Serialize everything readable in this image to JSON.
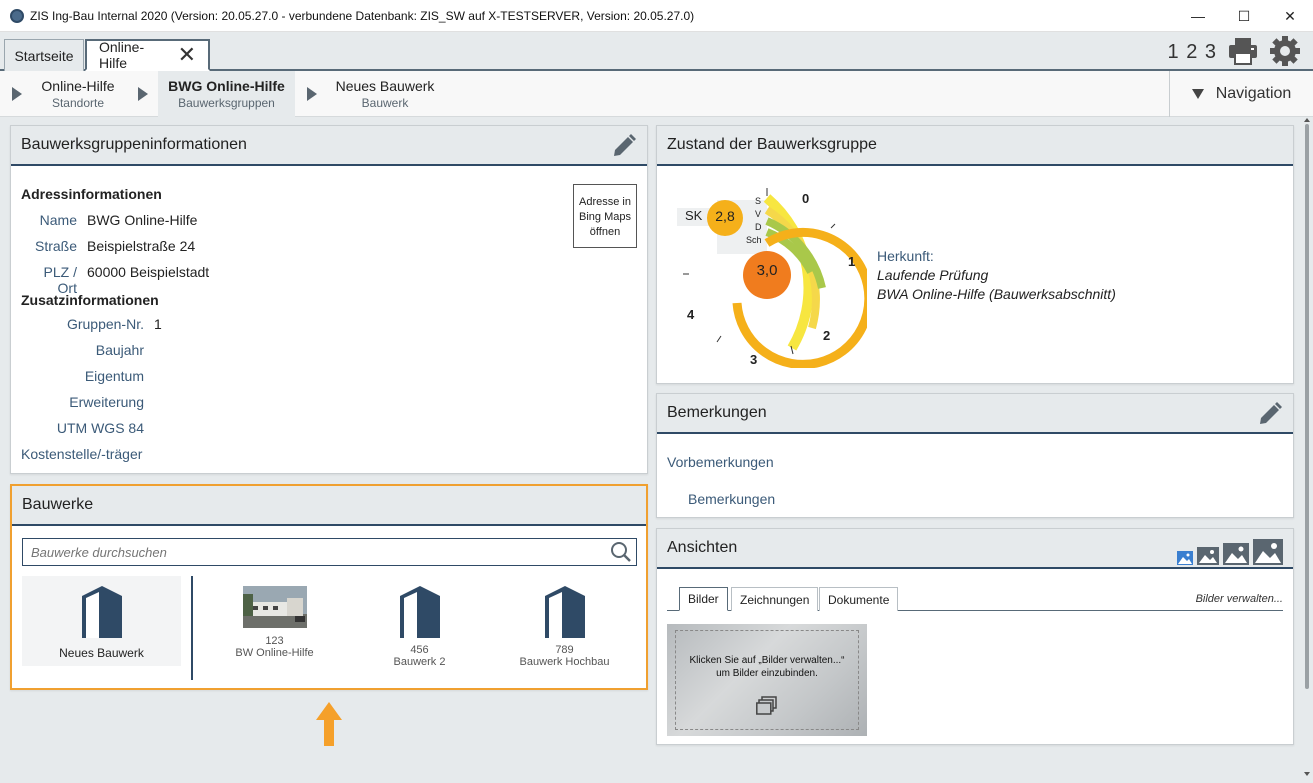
{
  "window": {
    "title": "ZIS Ing-Bau Internal 2020 (Version: 20.05.27.0 - verbundene Datenbank: ZIS_SW auf X-TESTSERVER, Version: 20.05.27.0)",
    "minimize": "—",
    "maximize": "☐",
    "close": "✕"
  },
  "tabs": [
    {
      "label": "Startseite"
    },
    {
      "label": "Online-Hilfe",
      "close": "✕"
    }
  ],
  "toolbar": {
    "numbers": "1 2 3",
    "print_icon": "printer-icon",
    "settings_icon": "gear-icon"
  },
  "breadcrumb": [
    {
      "title": "Online-Hilfe",
      "sub": "Standorte"
    },
    {
      "title": "BWG Online-Hilfe",
      "sub": "Bauwerksgruppen"
    },
    {
      "title": "Neues Bauwerk",
      "sub": "Bauwerk"
    }
  ],
  "navigation": {
    "label": "Navigation"
  },
  "info_panel": {
    "title": "Bauwerksgruppeninformationen",
    "address_heading": "Adressinformationen",
    "bing_button": "Adresse in Bing Maps öffnen",
    "address": [
      {
        "label": "Name",
        "value": "BWG Online-Hilfe"
      },
      {
        "label": "Straße",
        "value": "Beispielstraße 24"
      },
      {
        "label": "PLZ / Ort",
        "value": "60000 Beispielstadt"
      }
    ],
    "extra_heading": "Zusatzinformationen",
    "extra": [
      {
        "label": "Gruppen-Nr.",
        "value": "1"
      },
      {
        "label": "Baujahr",
        "value": ""
      },
      {
        "label": "Eigentum",
        "value": ""
      },
      {
        "label": "Erweiterung",
        "value": ""
      },
      {
        "label": "UTM WGS 84",
        "value": ""
      },
      {
        "label": "Kostenstelle/-träger",
        "value": ""
      }
    ]
  },
  "bauwerke_panel": {
    "title": "Bauwerke",
    "search_placeholder": "Bauwerke durchsuchen",
    "new_tile": "Neues Bauwerk",
    "items": [
      {
        "number": "123",
        "name": "BW Online-Hilfe",
        "thumb": "photo"
      },
      {
        "number": "456",
        "name": "Bauwerk 2",
        "thumb": "building-icon"
      },
      {
        "number": "789",
        "name": "Bauwerk Hochbau",
        "thumb": "building-icon"
      }
    ]
  },
  "zustand_panel": {
    "title": "Zustand der Bauwerksgruppe",
    "sk_label": "SK",
    "sk_value": "2,8",
    "center_value": "3,0",
    "ring_labels": [
      "S",
      "V",
      "D",
      "Sch"
    ],
    "scale_labels": [
      "0",
      "1",
      "2",
      "3",
      "4"
    ],
    "herkunft_label": "Herkunft:",
    "herkunft_line1": "Laufende Prüfung",
    "herkunft_line2": "BWA Online-Hilfe (Bauwerksabschnitt)"
  },
  "bemerkungen_panel": {
    "title": "Bemerkungen",
    "vorbemerkungen": "Vorbemerkungen",
    "bemerkungen": "Bemerkungen"
  },
  "ansichten_panel": {
    "title": "Ansichten",
    "tabs": [
      "Bilder",
      "Zeichnungen",
      "Dokumente"
    ],
    "manage_link": "Bilder verwalten...",
    "hint_line1": "Klicken Sie auf „Bilder verwalten...“",
    "hint_line2": "um Bilder einzubinden."
  },
  "colors": {
    "accent_dark": "#2f4a66",
    "orange_highlight": "#f0a030",
    "gauge_orange": "#f07c1e",
    "gauge_gold": "#f5b01a",
    "gauge_yellow": "#f7e640",
    "gauge_green": "#a9c84a"
  }
}
